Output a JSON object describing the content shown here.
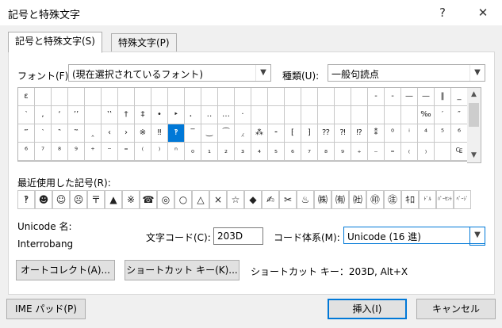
{
  "window": {
    "title": "記号と特殊文字",
    "help_label": "?",
    "close_label": "✕"
  },
  "tabs": [
    {
      "label": "記号と特殊文字(S)",
      "active": true
    },
    {
      "label": "特殊文字(P)",
      "active": false
    }
  ],
  "font": {
    "label": "フォント(F):",
    "value": "(現在選択されているフォント)"
  },
  "kind": {
    "label": "種類(U):",
    "value": "一般句読点"
  },
  "symbols": [
    [
      "ε",
      "",
      "",
      "",
      "",
      "",
      "",
      "",
      "",
      "",
      "",
      "",
      "",
      "",
      "",
      "",
      "",
      "",
      "",
      "",
      "",
      "-",
      "-",
      "—",
      "—",
      "‖",
      "_",
      ""
    ],
    [
      "‵",
      ",",
      "‘",
      "’’",
      "",
      "‛‛",
      "†",
      "‡",
      "•",
      "‣",
      "．",
      "‥",
      "…",
      "‧",
      "",
      "",
      "",
      "",
      "",
      "",
      "",
      "",
      "",
      "",
      "‰",
      "′",
      "″",
      ""
    ],
    [
      "‴",
      "‵",
      "‶",
      "‷",
      "‸",
      "‹",
      "›",
      "※",
      "‼",
      "‽",
      "‾",
      "‿",
      "⁀",
      "⁁",
      "⁂",
      "⁃",
      "⁅",
      "⁆",
      "⁇",
      "⁈",
      "⁉",
      "⁑",
      "⁰",
      "ⁱ",
      "⁴",
      "⁵",
      "⁶",
      ""
    ],
    [
      "⁶",
      "⁷",
      "⁸",
      "⁹",
      "⁺",
      "⁻",
      "⁼",
      "⁽",
      "⁾",
      "ⁿ",
      "₀",
      "₁",
      "₂",
      "₃",
      "₄",
      "₅",
      "₆",
      "₇",
      "₈",
      "₉",
      "₊",
      "₋",
      "₌",
      "₍",
      "₎",
      "",
      "₠",
      ""
    ]
  ],
  "selected_symbol": "‽",
  "recent": {
    "label": "最近使用した記号(R):",
    "items": [
      "‽",
      "☻",
      "☺",
      "☹",
      "〒",
      "▲",
      "※",
      "☎",
      "◎",
      "○",
      "△",
      "×",
      "☆",
      "◆",
      "✍",
      "✂",
      "♨",
      "㈱",
      "㈲",
      "㈳",
      "㊞",
      "㊟",
      "ｷﾛ",
      "ﾄﾞﾙ",
      "ﾊﾟｰｾﾝﾄ",
      "ﾍﾟｰｼﾞ"
    ]
  },
  "unicode_name": {
    "label": "Unicode 名:",
    "value": "Interrobang"
  },
  "char_code": {
    "label": "文字コード(C):",
    "value": "203D"
  },
  "code_system": {
    "label": "コード体系(M):",
    "value": "Unicode (16 進)"
  },
  "autocorrect_label": "オートコレクト(A)...",
  "shortcut_key_label": "ショートカット キー(K)...",
  "shortcut_info": "ショートカット キー：203D, Alt+X",
  "ime_pad_label": "IME パッド(P)",
  "insert_label": "挿入(I)",
  "cancel_label": "キャンセル"
}
